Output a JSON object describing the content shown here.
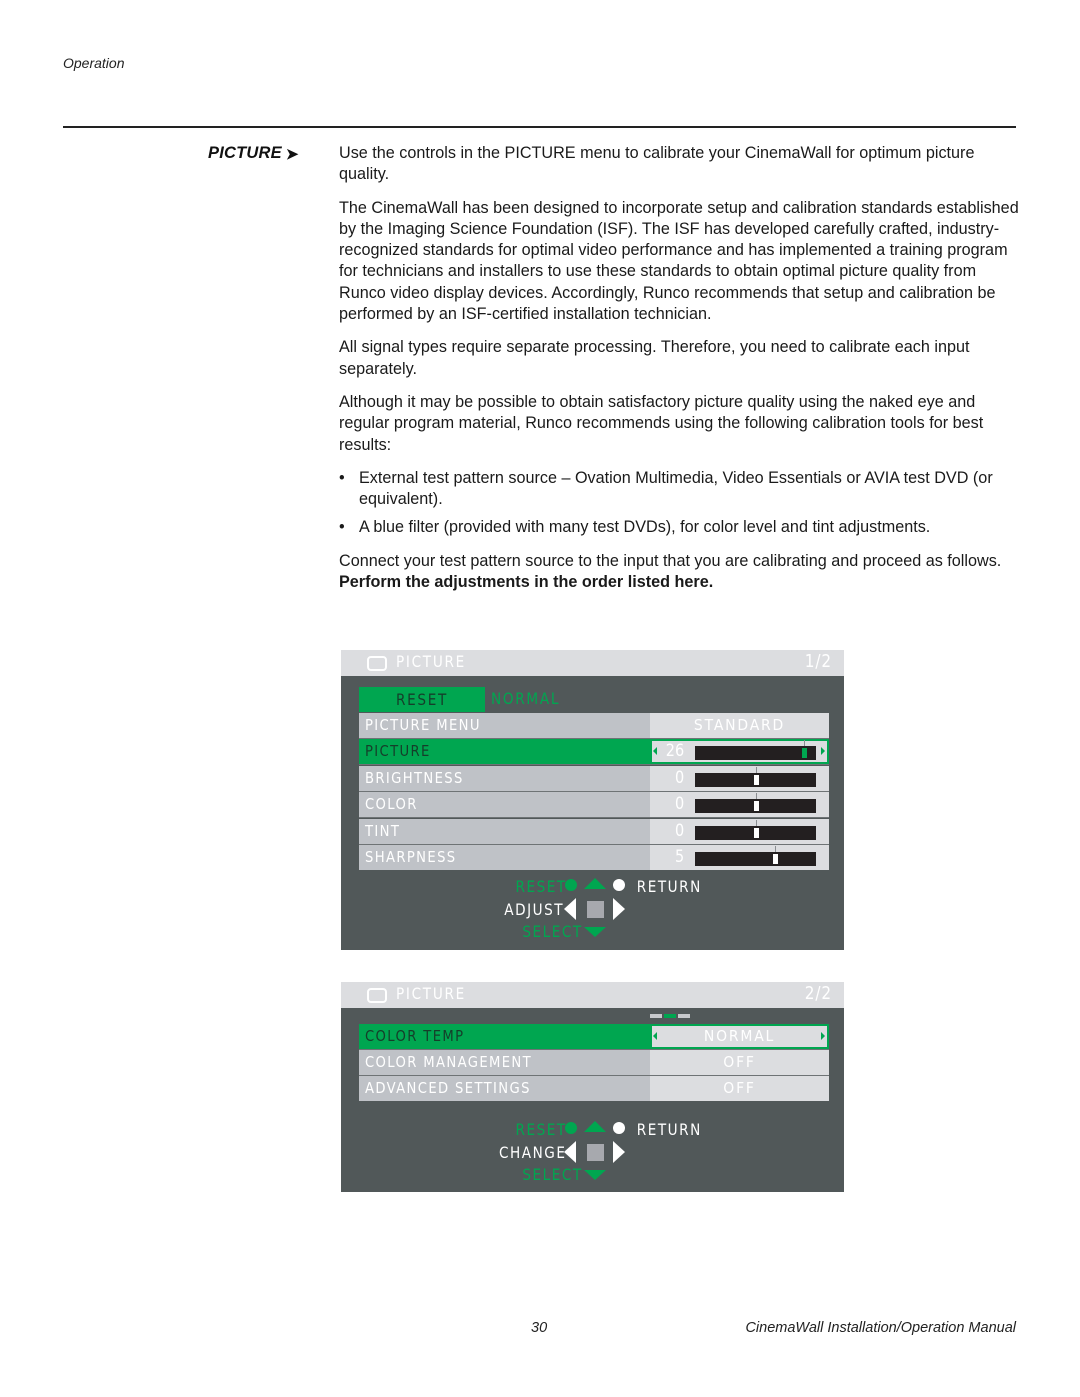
{
  "running_head": "Operation",
  "section": {
    "heading": "PICTURE",
    "arrow": "➤",
    "paragraphs": {
      "p1": "Use the controls in the PICTURE menu to calibrate your CinemaWall for optimum picture quality.",
      "p2": "The CinemaWall has been designed to incorporate setup and calibration standards established by the Imaging Science Foundation (ISF). The ISF has developed carefully crafted, industry-recognized standards for optimal video performance and has implemented a training program for technicians and installers to use these standards to obtain optimal picture quality from Runco video display devices. Accordingly, Runco recommends that setup and calibration be performed by an ISF-certified installation technician.",
      "p3": "All signal types require separate processing. Therefore, you need to calibrate each input separately.",
      "p4": "Although it may be possible to obtain satisfactory picture quality using the naked eye and regular program material, Runco recommends using the following calibration tools for best results:",
      "p5_plain": "Connect your test pattern source to the input that you are calibrating and proceed as follows. ",
      "p5_bold": "Perform the adjustments in the order listed here."
    },
    "bullets": [
      "External test pattern source – Ovation Multimedia, Video Essentials or AVIA test DVD (or equivalent).",
      "A blue filter (provided with many test DVDs), for color level and tint adjustments."
    ],
    "bullet_char": "•"
  },
  "osd_page1": {
    "title": "PICTURE",
    "pager": "1/2",
    "reset_label": "RESET",
    "reset_value": "NORMAL",
    "picture_menu": {
      "label": "PICTURE MENU",
      "value": "STANDARD"
    },
    "sliders": [
      {
        "label": "PICTURE",
        "value": "26",
        "selected": true,
        "position": 0.9
      },
      {
        "label": "BRIGHTNESS",
        "value": "0",
        "selected": false,
        "position": 0.5
      },
      {
        "label": "COLOR",
        "value": "0",
        "selected": false,
        "position": 0.5
      },
      {
        "label": "TINT",
        "value": "0",
        "selected": false,
        "position": 0.5
      },
      {
        "label": "SHARPNESS",
        "value": "5",
        "selected": false,
        "position": 0.66
      }
    ],
    "legend": {
      "reset": "RESET",
      "return": "RETURN",
      "action": "ADJUST",
      "select": "SELECT"
    }
  },
  "osd_page2": {
    "title": "PICTURE",
    "pager": "2/2",
    "rows": [
      {
        "label": "COLOR TEMP",
        "value": "NORMAL",
        "selected": true
      },
      {
        "label": "COLOR MANAGEMENT",
        "value": "OFF",
        "selected": false
      },
      {
        "label": "ADVANCED SETTINGS",
        "value": "OFF",
        "selected": false
      }
    ],
    "legend": {
      "reset": "RESET",
      "return": "RETURN",
      "action": "CHANGE",
      "select": "SELECT"
    }
  },
  "colors": {
    "osd_green": "#00a650",
    "osd_panel": "#515859",
    "osd_title_bar": "#dcdde0",
    "osd_label_bg": "#bfc2c7"
  },
  "footer": {
    "page_number": "30",
    "manual_title": "CinemaWall Installation/Operation Manual"
  }
}
